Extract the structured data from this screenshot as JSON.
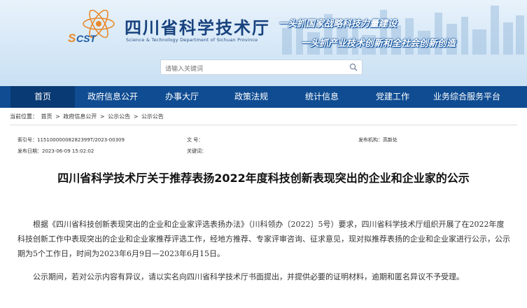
{
  "header": {
    "title": "四川省科学技术厅",
    "subtitle": "Science & Technology Department of Sichuan Province",
    "logo_text": "SCST",
    "slogan_1": "一头抓国家战略科技力量建设",
    "slogan_2": "一头抓产业技术创新和全社会创新创造",
    "search_placeholder": "请输入关键词"
  },
  "nav": {
    "items": [
      "首页",
      "政府信息公开",
      "办事大厅",
      "政策法规",
      "统计信息",
      "党建工作",
      "业务综合服务平台"
    ],
    "active": "首页"
  },
  "breadcrumb": {
    "label": "当前位置：",
    "items": [
      "首页",
      "政府信息公开",
      "公示公告",
      "公示公告"
    ],
    "separator": ">"
  },
  "meta": {
    "index_label": "索引号：",
    "index_value": "11510000008282399T/2023-00309",
    "doc_label": "文    号：",
    "doc_value": "",
    "org_label": "发布机构：",
    "org_value": "高新处",
    "date_label": "发布日期：",
    "date_value": "2023-06-09 15:02:02",
    "keyword_label": "关键词：",
    "keyword_value": ""
  },
  "article": {
    "title": "四川省科学技术厅关于推荐表扬2022年度科技创新表现突出的企业和企业家的公示",
    "paragraph_1": "根据《四川省科技创新表现突出的企业和企业家评选表扬办法》（川科领办〔2022〕5号）要求，四川省科学技术厅组织开展了在2022年度科技创新工作中表现突出的企业和企业家推荐评选工作，经地方推荐、专家评审咨询、征求意见，现对拟推荐表扬的企业和企业家进行公示，公示期为5个工作日，时间为2023年6月9日—2023年6月15日。",
    "paragraph_2": "公示期间，若对公示内容有异议，请以实名向四川省科学技术厅书面提出，并提供必要的证明材料，逾期和匿名异议不予受理。"
  },
  "colors": {
    "nav_bg": "#0f4c92",
    "nav_active_bg": "#0a3a73",
    "title_blue": "#17427e"
  }
}
